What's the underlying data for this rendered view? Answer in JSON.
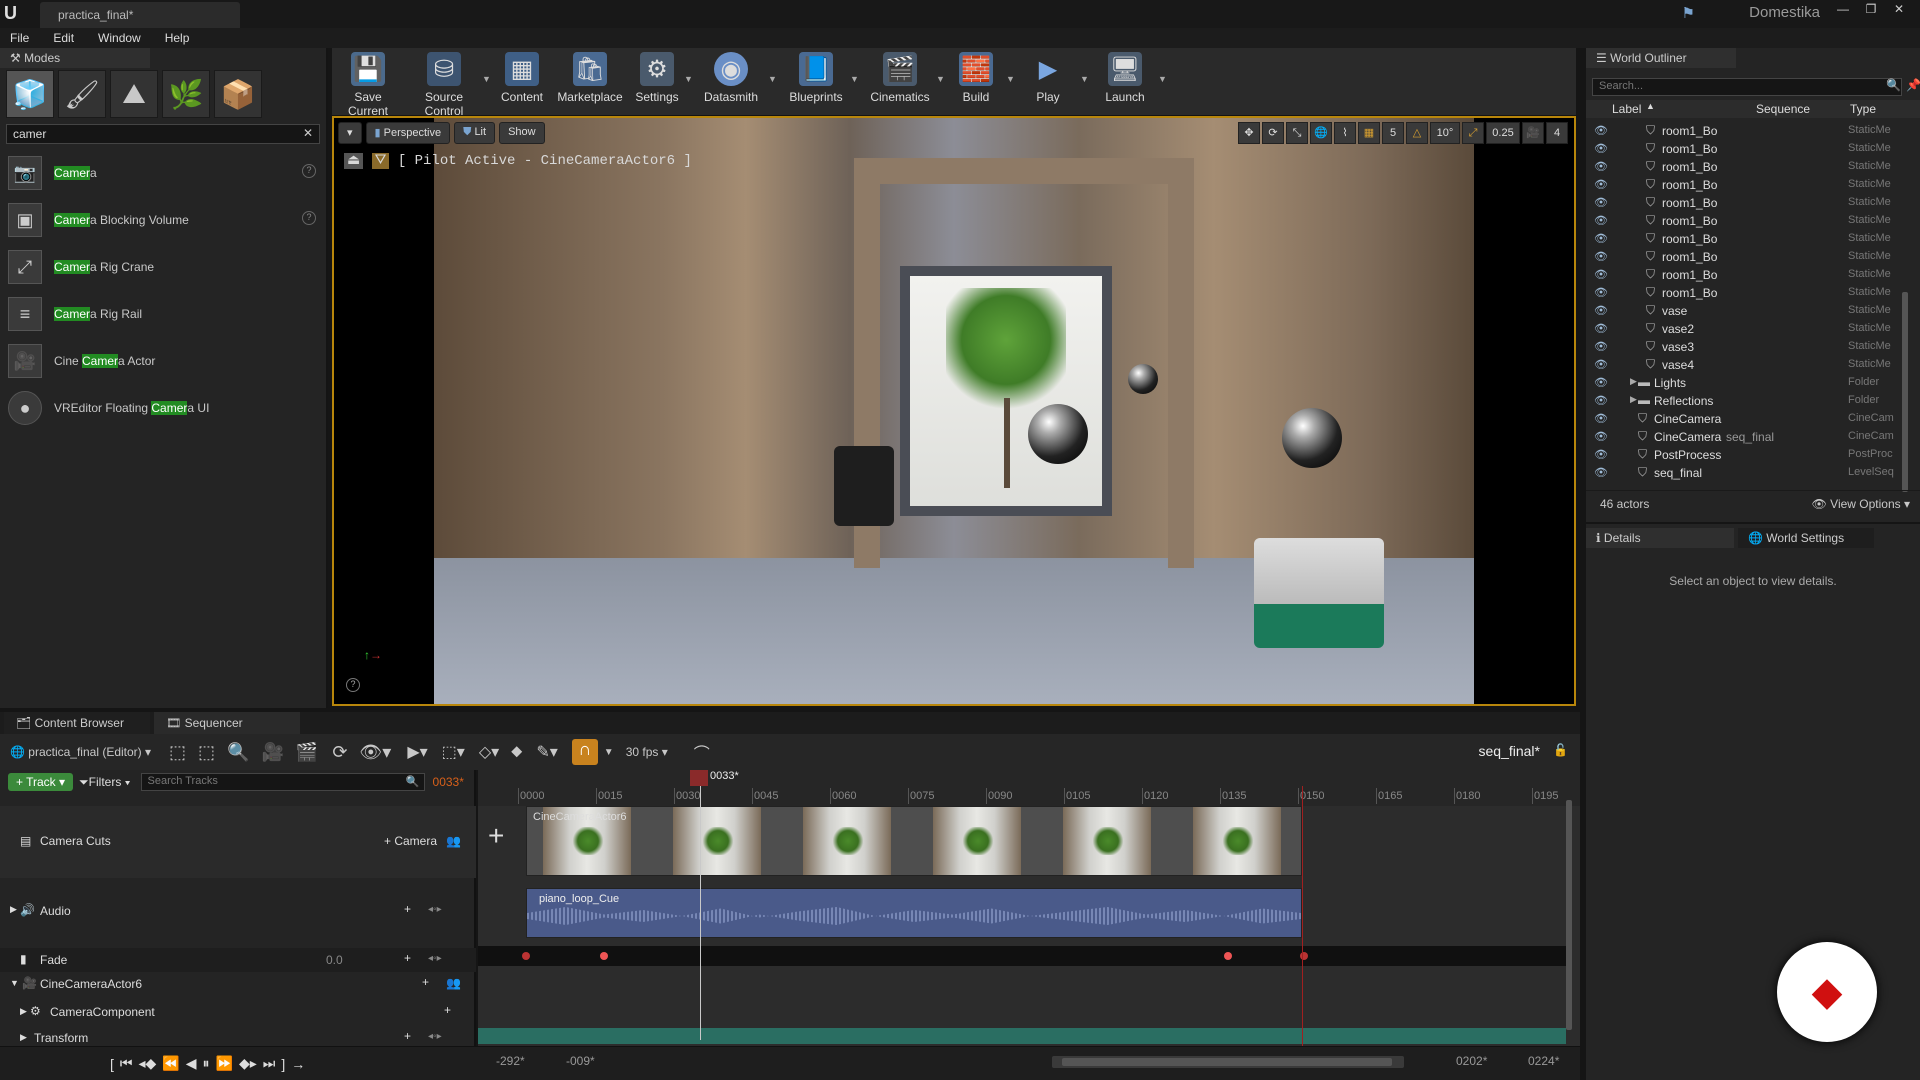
{
  "window": {
    "tab_title": "practica_final*",
    "user": "Domestika"
  },
  "menu": [
    "File",
    "Edit",
    "Window",
    "Help"
  ],
  "modes": {
    "panel_title": "Modes",
    "search_value": "camer",
    "results": [
      {
        "pre": "",
        "hl": "Camer",
        "post": "a"
      },
      {
        "pre": "",
        "hl": "Camer",
        "post": "a Blocking Volume"
      },
      {
        "pre": "",
        "hl": "Camer",
        "post": "a Rig Crane"
      },
      {
        "pre": "",
        "hl": "Camer",
        "post": "a Rig Rail"
      },
      {
        "pre": "Cine ",
        "hl": "Camer",
        "post": "a Actor"
      },
      {
        "pre": "VREditor Floating ",
        "hl": "Camer",
        "post": "a UI"
      }
    ]
  },
  "toolbar": {
    "buttons": [
      "Save Current",
      "Source Control",
      "Content",
      "Marketplace",
      "Settings",
      "Datasmith",
      "Blueprints",
      "Cinematics",
      "Build",
      "Play",
      "Launch"
    ]
  },
  "viewport": {
    "perspective": "Perspective",
    "lit": "Lit",
    "show": "Show",
    "pilot": "[ Pilot Active - CineCameraActor6 ]",
    "snap_grid": "5",
    "snap_rot": "10°",
    "snap_scale": "0.25",
    "cam_speed": "4"
  },
  "outliner": {
    "title": "World Outliner",
    "search_placeholder": "Search...",
    "columns": {
      "label": "Label",
      "sequence": "Sequence",
      "type": "Type"
    },
    "rows": [
      {
        "label": "room1_Bo",
        "type": "StaticMe"
      },
      {
        "label": "room1_Bo",
        "type": "StaticMe"
      },
      {
        "label": "room1_Bo",
        "type": "StaticMe"
      },
      {
        "label": "room1_Bo",
        "type": "StaticMe"
      },
      {
        "label": "room1_Bo",
        "type": "StaticMe"
      },
      {
        "label": "room1_Bo",
        "type": "StaticMe"
      },
      {
        "label": "room1_Bo",
        "type": "StaticMe"
      },
      {
        "label": "room1_Bo",
        "type": "StaticMe"
      },
      {
        "label": "room1_Bo",
        "type": "StaticMe"
      },
      {
        "label": "room1_Bo",
        "type": "StaticMe"
      },
      {
        "label": "vase",
        "type": "StaticMe"
      },
      {
        "label": "vase2",
        "type": "StaticMe"
      },
      {
        "label": "vase3",
        "type": "StaticMe"
      },
      {
        "label": "vase4",
        "type": "StaticMe"
      },
      {
        "label": "Lights",
        "type": "Folder"
      },
      {
        "label": "Reflections",
        "type": "Folder"
      },
      {
        "label": "CineCamera",
        "type": "CineCam"
      },
      {
        "label": "CineCamera",
        "sequence": "seq_final",
        "type": "CineCam"
      },
      {
        "label": "PostProcess",
        "type": "PostProc"
      },
      {
        "label": "seq_final",
        "type": "LevelSeq"
      }
    ],
    "actor_count": "46 actors",
    "view_options": "View Options"
  },
  "details": {
    "tab_details": "Details",
    "tab_world": "World Settings",
    "message": "Select an object to view details."
  },
  "bottom": {
    "tab_content": "Content Browser",
    "tab_sequencer": "Sequencer"
  },
  "sequencer": {
    "level": "practica_final (Editor)",
    "fps": "30 fps",
    "sequence_name": "seq_final*",
    "track_btn": "Track",
    "filters_btn": "Filters",
    "search_placeholder": "Search Tracks",
    "current_frame": "0033*",
    "tracks": {
      "camera_cuts": "Camera Cuts",
      "camera_add": "Camera",
      "audio": "Audio",
      "fade": "Fade",
      "fade_value": "0.0",
      "cine_actor": "CineCameraActor6",
      "camera_component": "CameraComponent",
      "transform": "Transform"
    },
    "ticks": [
      "0000",
      "0015",
      "0030",
      "0045",
      "0060",
      "0075",
      "0090",
      "0105",
      "0120",
      "0135",
      "0150",
      "0165",
      "0180",
      "0195"
    ],
    "clip_camera": "CineCameraActor6",
    "clip_audio": "piano_loop_Cue",
    "range_start": "-292*",
    "range_view_start": "-009*",
    "range_view_end": "0202*",
    "range_end": "0224*"
  }
}
